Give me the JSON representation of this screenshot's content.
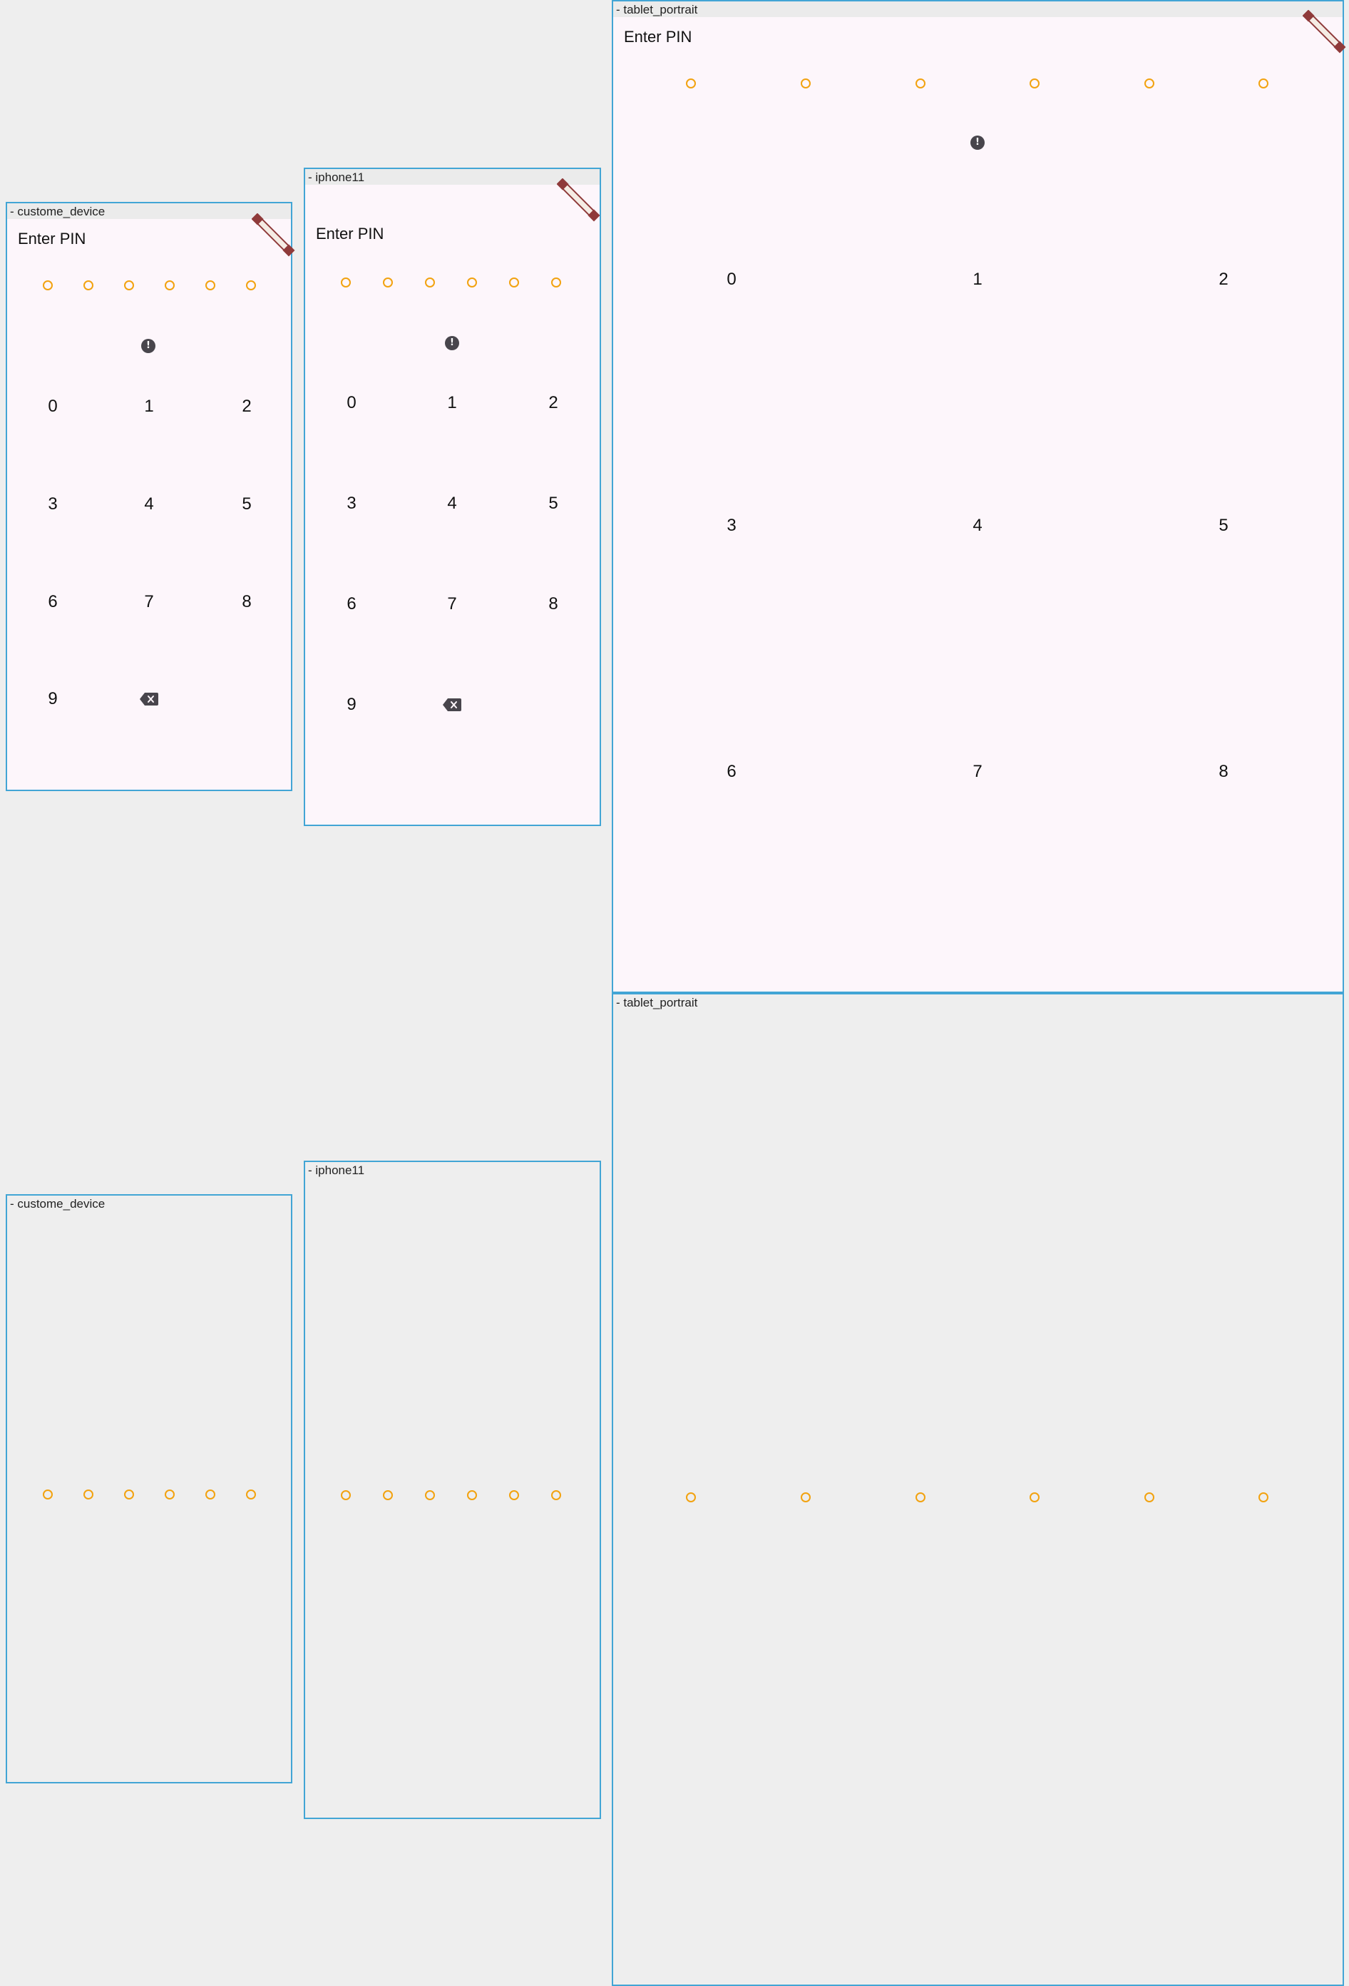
{
  "frames": [
    {
      "label": "- custome_device"
    },
    {
      "label": "- iphone11"
    },
    {
      "label": "- tablet_portrait"
    },
    {
      "label": "- tablet_portrait"
    },
    {
      "label": "- custome_device"
    },
    {
      "label": "- iphone11"
    }
  ],
  "pin_screen": {
    "title": "Enter PIN",
    "digit_count": 6,
    "keys": [
      "0",
      "1",
      "2",
      "3",
      "4",
      "5",
      "6",
      "7",
      "8",
      "9"
    ],
    "alert_glyph": "!",
    "icons": {
      "alert": "error-circle-icon",
      "backspace": "backspace-icon",
      "debug": "debug-banner-icon"
    }
  },
  "colors": {
    "accent_dot": "#f2a20f",
    "frame_border": "#42a5d5",
    "screen_bg": "#fdf6fb",
    "canvas_bg": "#eeeeee",
    "icon": "#48454c"
  }
}
